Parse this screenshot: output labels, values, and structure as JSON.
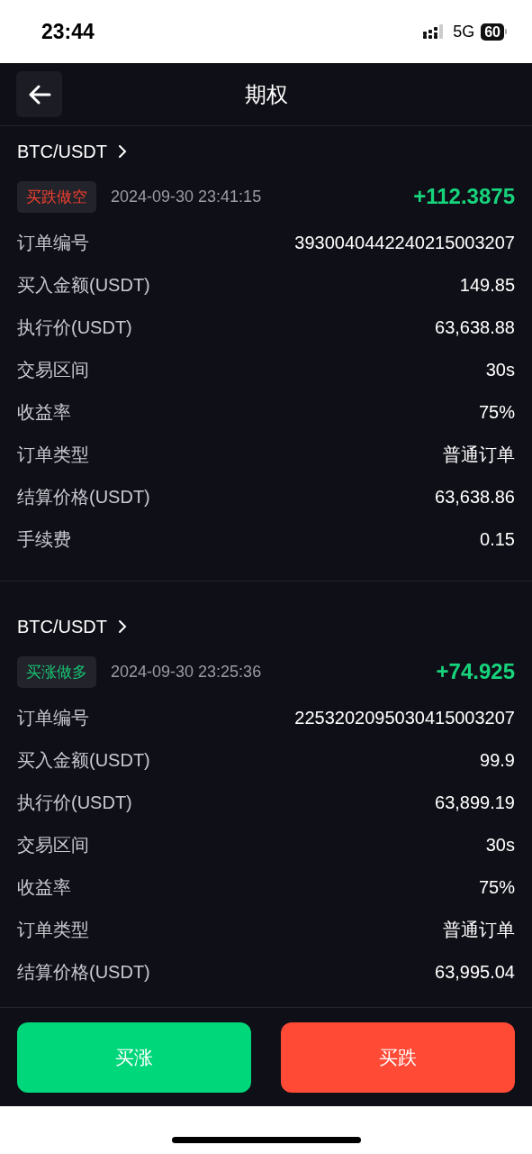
{
  "status_bar": {
    "time": "23:44",
    "network": "5G",
    "battery": "60"
  },
  "header": {
    "title": "期权"
  },
  "orders": [
    {
      "pair": "BTC/USDT",
      "direction": {
        "kind": "short",
        "label": "买跌做空"
      },
      "time": "2024-09-30 23:41:15",
      "pnl": "+112.3875",
      "fields": [
        {
          "label": "订单编号",
          "value": "3930040442240215003207"
        },
        {
          "label": "买入金额(USDT)",
          "value": "149.85"
        },
        {
          "label": "执行价(USDT)",
          "value": "63,638.88"
        },
        {
          "label": "交易区间",
          "value": "30s"
        },
        {
          "label": "收益率",
          "value": "75%"
        },
        {
          "label": "订单类型",
          "value": "普通订单"
        },
        {
          "label": "结算价格(USDT)",
          "value": "63,638.86"
        },
        {
          "label": "手续费",
          "value": "0.15"
        }
      ]
    },
    {
      "pair": "BTC/USDT",
      "direction": {
        "kind": "long",
        "label": "买涨做多"
      },
      "time": "2024-09-30 23:25:36",
      "pnl": "+74.925",
      "fields": [
        {
          "label": "订单编号",
          "value": "2253202095030415003207"
        },
        {
          "label": "买入金额(USDT)",
          "value": "99.9"
        },
        {
          "label": "执行价(USDT)",
          "value": "63,899.19"
        },
        {
          "label": "交易区间",
          "value": "30s"
        },
        {
          "label": "收益率",
          "value": "75%"
        },
        {
          "label": "订单类型",
          "value": "普通订单"
        },
        {
          "label": "结算价格(USDT)",
          "value": "63,995.04"
        }
      ]
    }
  ],
  "actions": [
    {
      "kind": "buy_up",
      "label": "买涨"
    },
    {
      "kind": "buy_down",
      "label": "买跌"
    }
  ]
}
